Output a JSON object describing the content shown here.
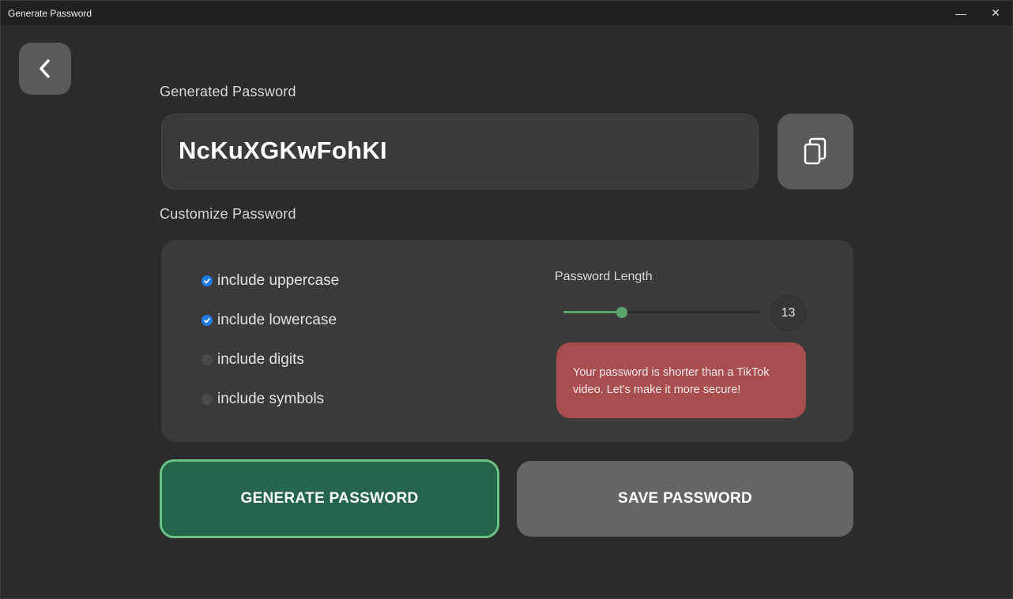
{
  "window": {
    "title": "Generate Password",
    "minimize_glyph": "—",
    "close_glyph": "✕"
  },
  "back_button": {
    "icon": "chevron-left-icon"
  },
  "generated": {
    "label": "Generated Password",
    "password": "NcKuXGKwFohKI",
    "copy_icon": "copy-icon"
  },
  "customize": {
    "label": "Customize Password",
    "options": [
      {
        "label": "include uppercase",
        "checked": true
      },
      {
        "label": "include lowercase",
        "checked": true
      },
      {
        "label": "include digits",
        "checked": false
      },
      {
        "label": "include symbols",
        "checked": false
      }
    ],
    "length": {
      "label": "Password Length",
      "value": "13",
      "slider_fraction": 0.3
    },
    "warning": "Your password is shorter than a TikTok video. Let's make it more secure!"
  },
  "actions": {
    "generate_label": "GENERATE PASSWORD",
    "save_label": "SAVE PASSWORD"
  },
  "colors": {
    "accent_green": "#5aa36b",
    "generate_bg": "#25664a",
    "warning_bg": "#a84e4e",
    "checkbox_blue": "#1f7be6"
  }
}
